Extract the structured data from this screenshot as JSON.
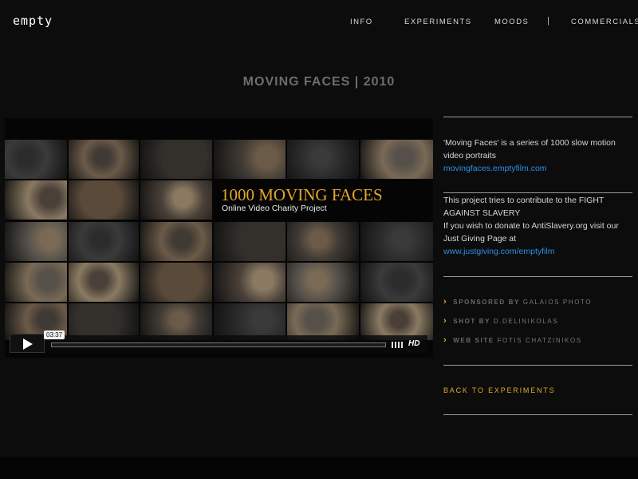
{
  "logo": {
    "text": "empty"
  },
  "nav": {
    "items": [
      {
        "label": "INFO"
      },
      {
        "label": "EXPERIMENTS"
      },
      {
        "label": "MOODS"
      },
      {
        "label": "COMMERCIALS"
      }
    ],
    "separator": "|"
  },
  "page": {
    "title": "MOVING FACES | 2010"
  },
  "video": {
    "banner_title": "1000 MOVING FACES",
    "banner_subtitle": "Online Video Charity Project",
    "time": "03:37",
    "hd_label": "HD"
  },
  "sidebar": {
    "description_line1": "'Moving Faces' is a series of 1000 slow motion video portraits",
    "description_link1": "movingfaces.emptyfilm.com",
    "project_text": "This project tries to contribute to the FIGHT AGAINST SLAVERY",
    "donate_text": "If you wish to donate to AntiSlavery.org visit our Just Giving Page at",
    "donate_link": "www.justgiving.com/emptyfilm",
    "credits": [
      {
        "key": "SPONSORED BY",
        "value": "GALAIOS PHOTO"
      },
      {
        "key": "SHOT BY",
        "value": "D.DELINIKOLAS"
      },
      {
        "key": "WEB SITE",
        "value": "FOTIS CHATZINIKOS"
      }
    ],
    "back_label": "BACK TO EXPERIMENTS"
  },
  "colors": {
    "background": "#0c0c0c",
    "accent": "#e4a628",
    "link": "#2f8fe8"
  }
}
